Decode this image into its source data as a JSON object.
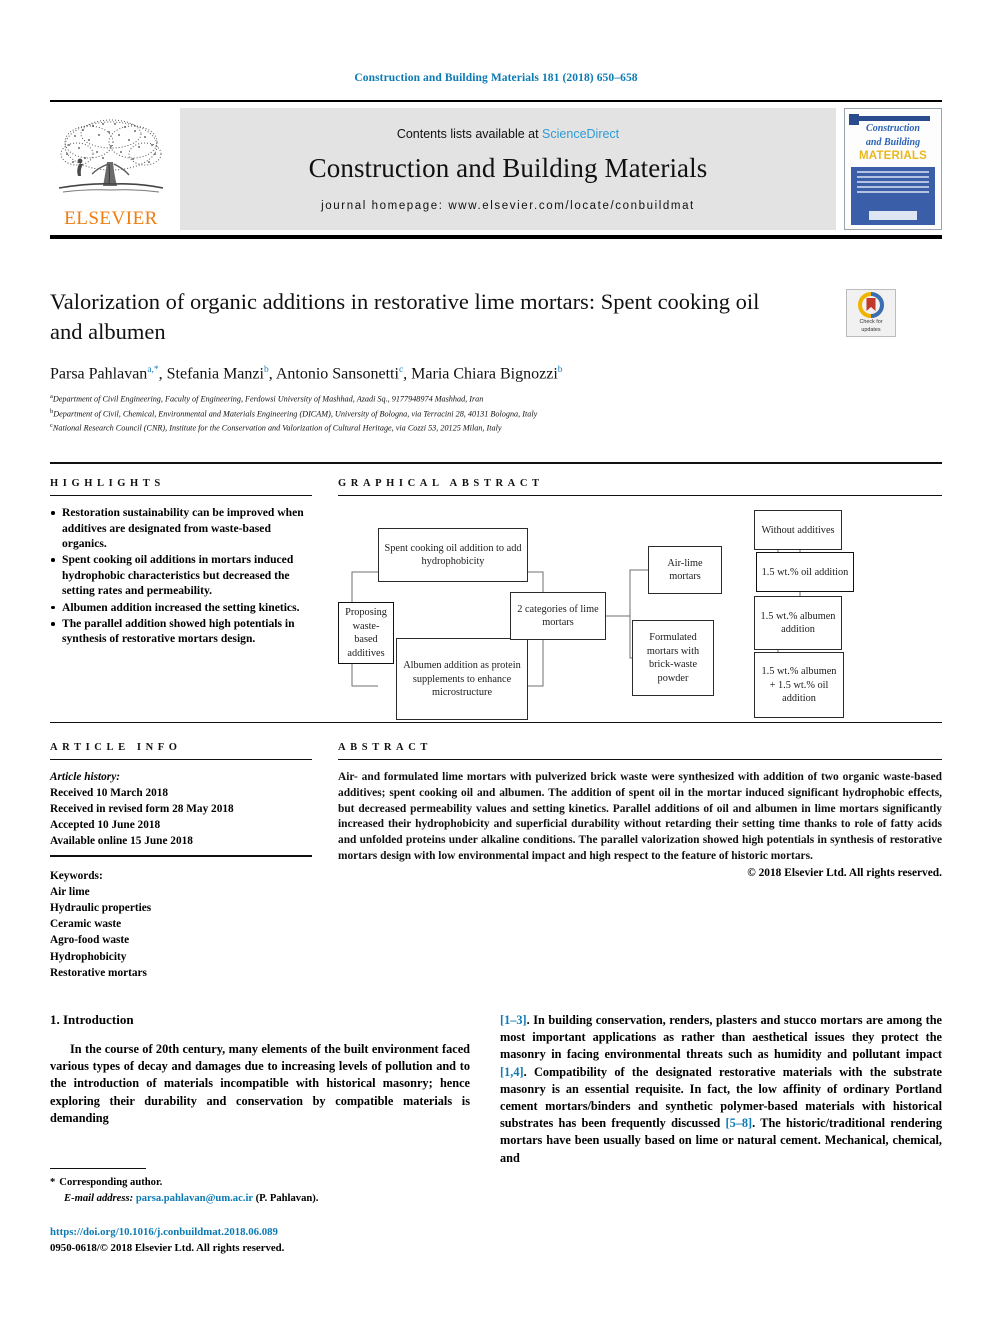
{
  "running_head": "Construction and Building Materials 181 (2018) 650–658",
  "masthead": {
    "publisher_name": "ELSEVIER",
    "contents_prefix": "Contents lists available at ",
    "contents_link": "ScienceDirect",
    "journal_title": "Construction and Building Materials",
    "homepage": "journal homepage: www.elsevier.com/locate/conbuildmat",
    "cover": {
      "line1": "Construction",
      "line2": "and Building",
      "line3": "MATERIALS"
    }
  },
  "title": "Valorization of organic additions in restorative lime mortars: Spent cooking oil and albumen",
  "crossmark": {
    "line1": "Check for",
    "line2": "updates"
  },
  "authors": [
    {
      "name": "Parsa Pahlavan",
      "marks": "a,*"
    },
    {
      "name": "Stefania Manzi",
      "marks": "b"
    },
    {
      "name": "Antonio Sansonetti",
      "marks": "c"
    },
    {
      "name": "Maria Chiara Bignozzi",
      "marks": "b"
    }
  ],
  "affiliations": [
    {
      "mark": "a",
      "text": "Department of Civil Engineering, Faculty of Engineering, Ferdowsi University of Mashhad, Azadi Sq., 9177948974 Mashhad, Iran"
    },
    {
      "mark": "b",
      "text": "Department of Civil, Chemical, Environmental and Materials Engineering (DICAM), University of Bologna, via Terracini 28, 40131 Bologna, Italy"
    },
    {
      "mark": "c",
      "text": "National Research Council (CNR), Institute for the Conservation and Valorization of Cultural Heritage, via Cozzi 53, 20125 Milan, Italy"
    }
  ],
  "sections": {
    "highlights_heading": "HIGHLIGHTS",
    "graphical_abstract_heading": "GRAPHICAL ABSTRACT",
    "article_info_heading": "ARTICLE INFO",
    "abstract_heading": "ABSTRACT"
  },
  "highlights": [
    "Restoration sustainability can be improved when additives are designated from waste-based organics.",
    "Spent cooking oil additions in mortars induced hydrophobic characteristics but decreased the setting rates and permeability.",
    "Albumen addition increased the setting kinetics.",
    "The parallel addition showed high potentials in synthesis of restorative mortars design."
  ],
  "article_history": {
    "label": "Article history:",
    "items": [
      "Received 10 March 2018",
      "Received in revised form 28 May 2018",
      "Accepted 10 June 2018",
      "Available online 15 June 2018"
    ]
  },
  "keywords": {
    "label": "Keywords:",
    "items": [
      "Air lime",
      "Hydraulic properties",
      "Ceramic waste",
      "Agro-food waste",
      "Hydrophobicity",
      "Restorative mortars"
    ]
  },
  "abstract": "Air- and formulated lime mortars with pulverized brick waste were synthesized with addition of two organic waste-based additives; spent cooking oil and albumen. The addition of spent oil in the mortar induced significant hydrophobic effects, but decreased permeability values and setting kinetics. Parallel additions of oil and albumen in lime mortars significantly increased their hydrophobicity and superficial durability without retarding their setting time thanks to role of fatty acids and unfolded proteins under alkaline conditions. The parallel valorization showed high potentials in synthesis of restorative mortars design with low environmental impact and high respect to the feature of historic mortars.",
  "copyright": "© 2018 Elsevier Ltd. All rights reserved.",
  "graphical_abstract": {
    "boxes": {
      "proposing": "Proposing waste-based additives",
      "oil": "Spent cooking oil addition to add hydrophobicity",
      "albumen": "Albumen addition as protein supplements to enhance microstructure",
      "categories": "2 categories of lime mortars",
      "airlime": "Air-lime mortars",
      "formulated": "Formulated mortars with brick-waste powder",
      "without": "Without additives",
      "oil15": "1.5 wt.% oil addition",
      "alb15": "1.5 wt.% albumen addition",
      "both15": "1.5 wt.% albumen + 1.5 wt.% oil addition"
    }
  },
  "body": {
    "section_title": "1. Introduction",
    "left_paragraph": "In the course of 20th century, many elements of the built environment faced various types of decay and damages due to increasing levels of pollution and to the introduction of materials incompatible with historical masonry; hence exploring their durability and conservation by compatible materials is demanding",
    "right_paragraph_parts": [
      {
        "type": "ref",
        "text": "[1–3]"
      },
      {
        "type": "text",
        "text": ". In building conservation, renders, plasters and stucco mortars are among the most important applications as rather than aesthetical issues they protect the masonry in facing environmental threats such as humidity and pollutant impact "
      },
      {
        "type": "ref",
        "text": "[1,4]"
      },
      {
        "type": "text",
        "text": ". Compatibility of the designated restorative materials with the substrate masonry is an essential requisite. In fact, the low affinity of ordinary Portland cement mortars/binders and synthetic polymer-based materials with historical substrates has been frequently discussed "
      },
      {
        "type": "ref",
        "text": "[5–8]"
      },
      {
        "type": "text",
        "text": ". The historic/traditional rendering mortars have been usually based on lime or natural cement. Mechanical, chemical, and"
      }
    ]
  },
  "footnotes": {
    "star": "*",
    "corresponding": "Corresponding author.",
    "email_label": "E-mail address:",
    "email": "parsa.pahlavan@um.ac.ir",
    "email_suffix": "(P. Pahlavan)."
  },
  "doi": "https://doi.org/10.1016/j.conbuildmat.2018.06.089",
  "issn_line": "0950-0618/© 2018 Elsevier Ltd. All rights reserved.",
  "colors": {
    "link_blue": "#0b7ab5",
    "sciencedirect_blue": "#2e9bd6",
    "elsevier_orange": "#ef7d10",
    "cover_blue": "#3a5fa8",
    "cover_yellow": "#e8b820"
  }
}
